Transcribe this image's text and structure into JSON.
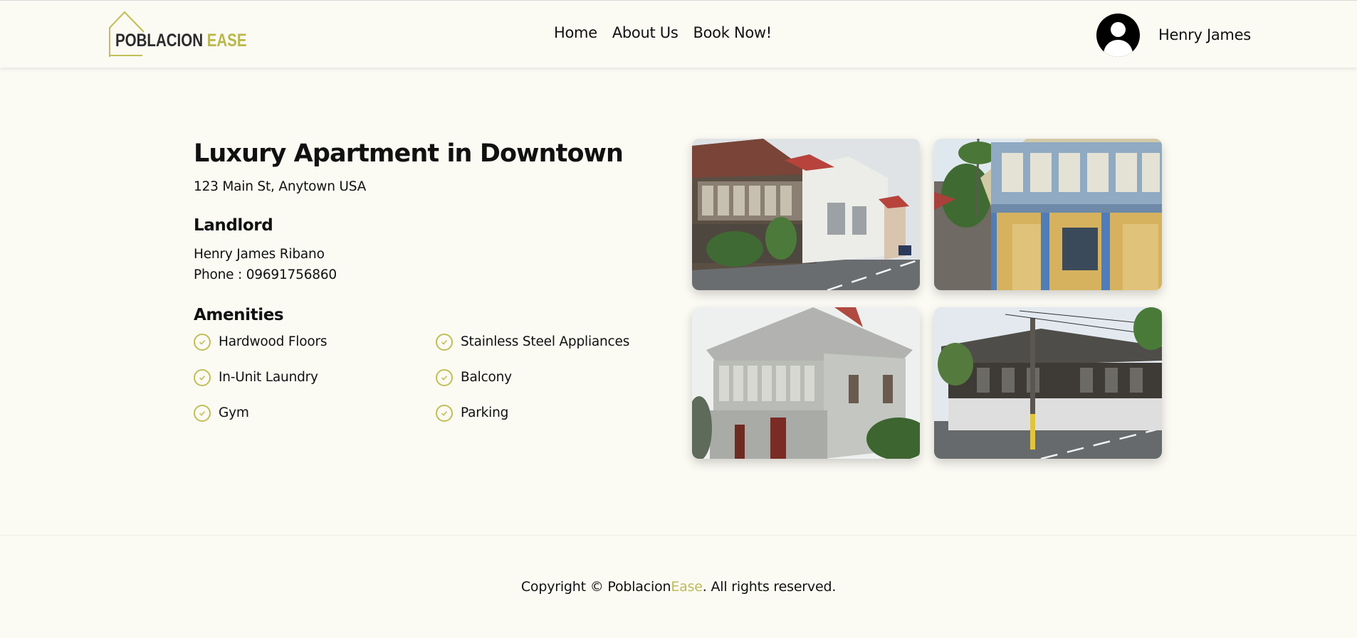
{
  "brand": {
    "name_part1": "POBLACION",
    "name_part2": "EASE"
  },
  "nav": {
    "links": [
      "Home",
      "About Us",
      "Book Now!"
    ]
  },
  "user": {
    "name": "Henry James",
    "avatar_icon": "user-circle-icon"
  },
  "listing": {
    "title": "Luxury Apartment in Downtown",
    "address": "123 Main St, Anytown USA",
    "landlord_heading": "Landlord",
    "landlord_name": "Henry James Ribano",
    "landlord_phone": "Phone : 09691756860",
    "amenities_heading": "Amenities",
    "amenities": [
      "Hardwood Floors",
      "Stainless Steel Appliances",
      "In-Unit Laundry",
      "Balcony",
      "Gym",
      "Parking"
    ],
    "amenity_icon": "check-circle-icon"
  },
  "footer": {
    "prefix": "Copyright © Poblacion",
    "brand_accent": "Ease",
    "suffix": ". All rights reserved."
  },
  "colors": {
    "accent": "#bcbb5a",
    "background": "#fbfaf3",
    "text": "#111111"
  }
}
